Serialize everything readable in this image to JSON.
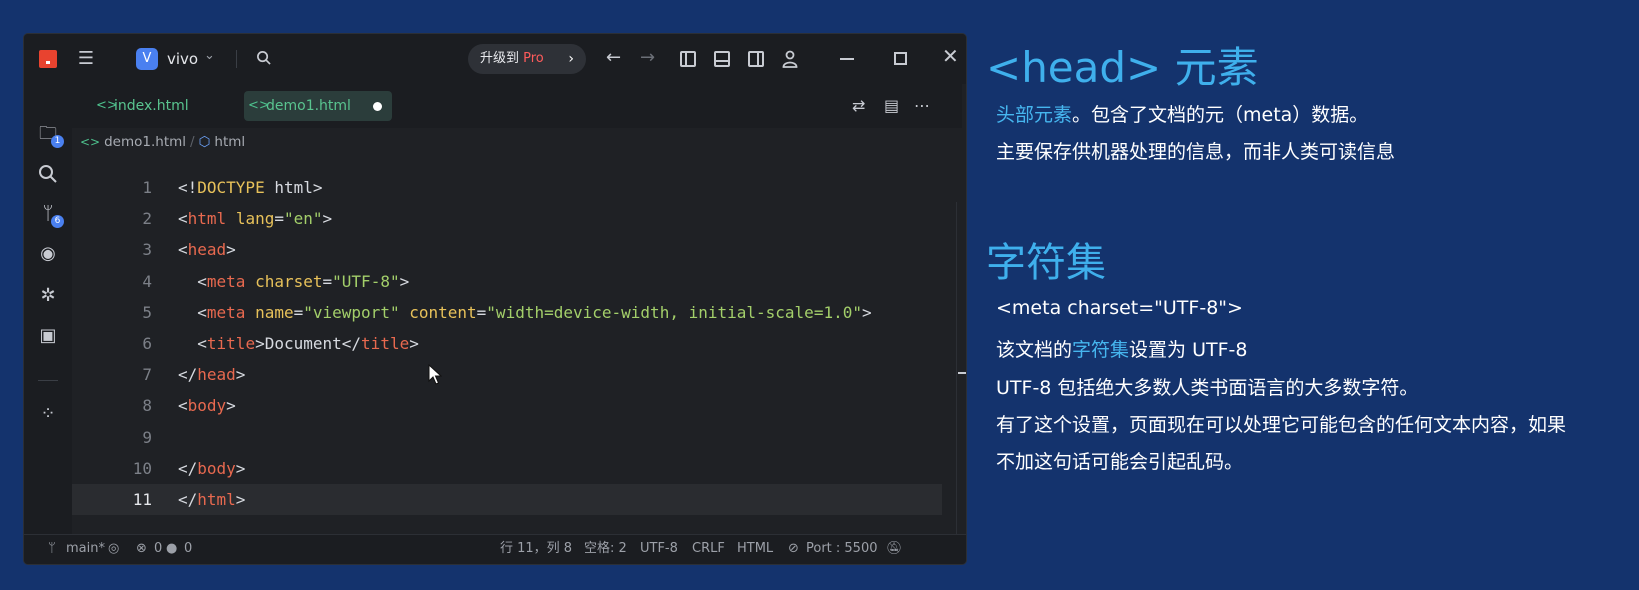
{
  "window": {
    "project_badge": "V",
    "project_name": "vivo",
    "upgrade_prefix": "升级到 ",
    "upgrade_pro": "Pro"
  },
  "activity": {
    "explorer_badge": "1",
    "scm_badge": "6"
  },
  "tabs": [
    {
      "label": "index.html",
      "active": false
    },
    {
      "label": "demo1.html",
      "active": true,
      "modified": true
    }
  ],
  "breadcrumb": {
    "file": "demo1.html",
    "symbol": "html"
  },
  "code_lines": [
    {
      "n": "1",
      "html": "<span class='p'>&lt;!</span><span class='d'>DOCTYPE</span> <span class='p'>html&gt;</span>"
    },
    {
      "n": "2",
      "html": "<span class='p'>&lt;</span><span class='t'>html</span> <span class='a'>lang</span><span class='p'>=</span><span class='s'>\"en\"</span><span class='p'>&gt;</span>"
    },
    {
      "n": "3",
      "html": "<span class='p'>&lt;</span><span class='t'>head</span><span class='p'>&gt;</span>"
    },
    {
      "n": "4",
      "html": "  <span class='p'>&lt;</span><span class='t'>meta</span> <span class='a'>charset</span><span class='p'>=</span><span class='s'>\"UTF-8\"</span><span class='p'>&gt;</span>"
    },
    {
      "n": "5",
      "html": "  <span class='p'>&lt;</span><span class='t'>meta</span> <span class='a'>name</span><span class='p'>=</span><span class='s'>\"viewport\"</span> <span class='a'>content</span><span class='p'>=</span><span class='s'>\"width=device-width, initial-scale=1.0\"</span><span class='p'>&gt;</span>"
    },
    {
      "n": "6",
      "html": "  <span class='p'>&lt;</span><span class='t'>title</span><span class='p'>&gt;Document&lt;/</span><span class='t'>title</span><span class='p'>&gt;</span>"
    },
    {
      "n": "7",
      "html": "<span class='p'>&lt;/</span><span class='t'>head</span><span class='p'>&gt;</span>"
    },
    {
      "n": "8",
      "html": "<span class='p'>&lt;</span><span class='t'>body</span><span class='p'>&gt;</span>"
    },
    {
      "n": "9",
      "html": ""
    },
    {
      "n": "10",
      "html": "<span class='p'>&lt;/</span><span class='t'>body</span><span class='p'>&gt;</span>"
    },
    {
      "n": "11",
      "html": "<span class='p'>&lt;/</span><span class='t'>html</span><span class='p'>&gt;</span>",
      "current": true
    }
  ],
  "statusbar": {
    "branch": "main*",
    "errors": "0",
    "warnings": "0",
    "position": "行 11，列 8",
    "indent": "空格: 2",
    "encoding": "UTF-8",
    "eol": "CRLF",
    "language": "HTML",
    "port": "Port : 5500"
  },
  "notes": {
    "title1": "<head> 元素",
    "line1_hl": "头部元素",
    "line1_rest": "。包含了文档的元（meta）数据。",
    "line2": "主要保存供机器处理的信息，而非人类可读信息",
    "title2": "字符集",
    "line3": "<meta charset=\"UTF-8\">",
    "line4_pre": "该文档的",
    "line4_hl": "字符集",
    "line4_post": "设置为 UTF-8",
    "line5": "UTF-8 包括绝大多数人类书面语言的大多数字符。",
    "line6": "有了这个设置，页面现在可以处理它可能包含的任何文本内容，如果",
    "line7": "不加这句话可能会引起乱码。"
  },
  "colors": {
    "background": "#14336d",
    "accent": "#3fb0ec",
    "tag": "#e8694f",
    "string": "#a3cf6a",
    "attr": "#e7c15a"
  }
}
